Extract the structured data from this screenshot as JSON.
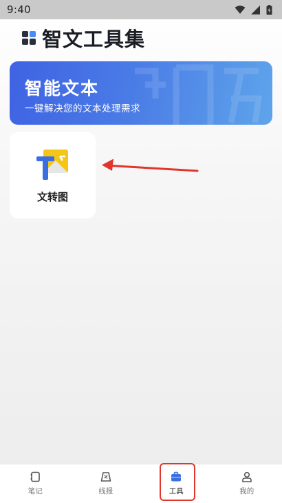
{
  "status_bar": {
    "time": "9:40"
  },
  "header": {
    "title": "智文工具集"
  },
  "banner": {
    "title": "智能文本",
    "subtitle": "一键解决您的文本处理需求",
    "colors": {
      "start": "#3f63e3",
      "end": "#5ea4ea"
    }
  },
  "tools": [
    {
      "label": "文转图",
      "icon": "text-to-image-icon"
    }
  ],
  "tab_bar": {
    "items": [
      {
        "label": "笔记",
        "icon": "notebook-icon"
      },
      {
        "label": "线报",
        "icon": "tag-icon"
      },
      {
        "label": "工具",
        "icon": "briefcase-icon",
        "active": true
      },
      {
        "label": "我的",
        "icon": "user-icon"
      }
    ]
  },
  "colors": {
    "accent": "#4a8bf5",
    "highlight": "#e0362c"
  }
}
